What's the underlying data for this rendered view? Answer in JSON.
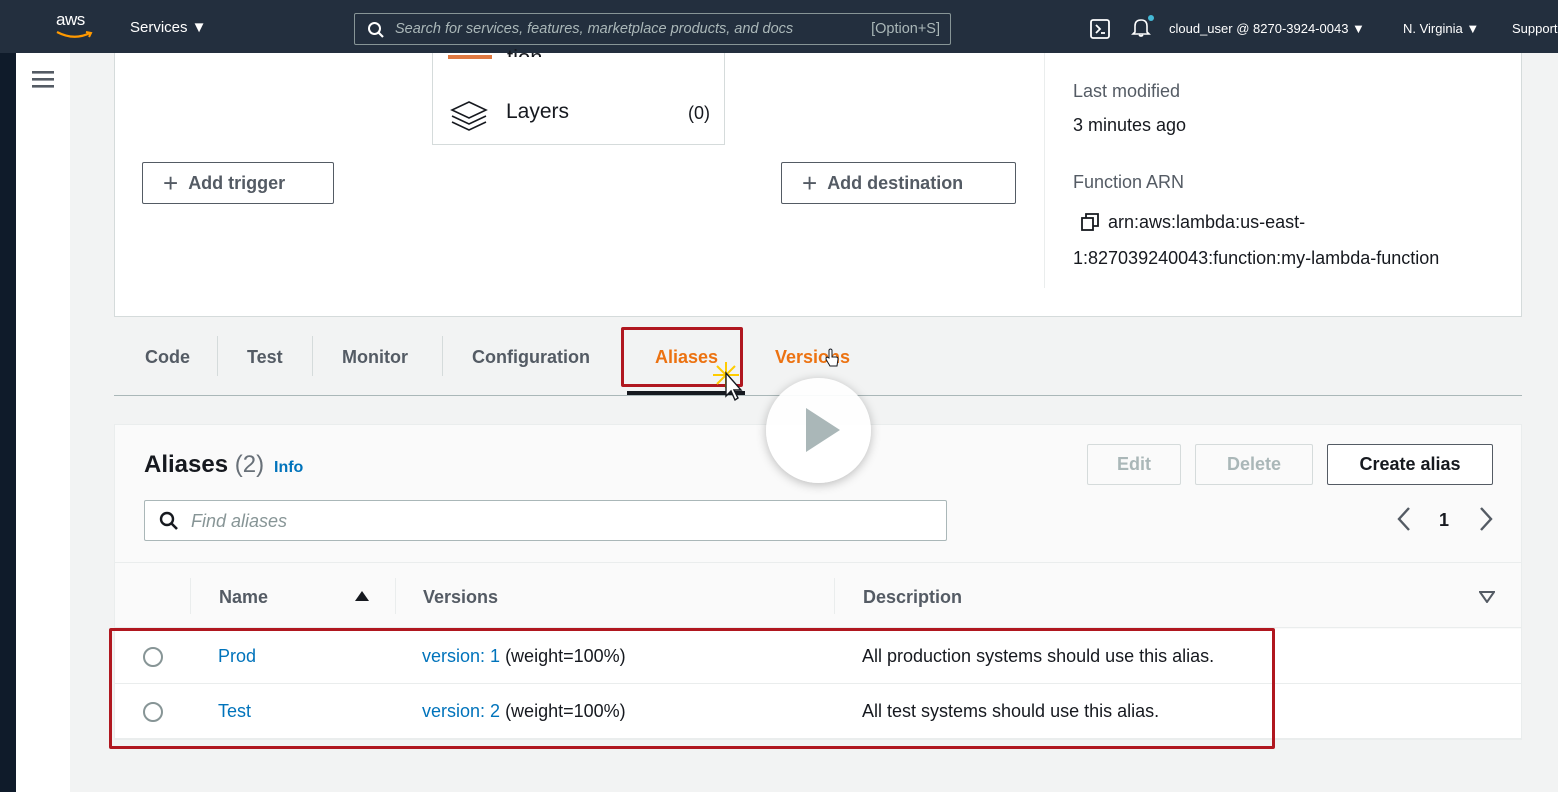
{
  "topnav": {
    "logo": "aws",
    "services": "Services ▼",
    "search_placeholder": "Search for services, features, marketplace products, and docs",
    "search_shortcut": "[Option+S]",
    "user": "cloud_user @ 8270-3924-0043 ▼",
    "region": "N. Virginia ▼",
    "support": "Support"
  },
  "overview": {
    "partial_title": "tion",
    "layers_label": "Layers",
    "layers_count": "(0)",
    "add_trigger": "Add trigger",
    "add_destination": "Add destination",
    "last_modified_label": "Last modified",
    "last_modified_value": "3 minutes ago",
    "arn_label": "Function ARN",
    "arn_line1": "arn:aws:lambda:us-east-",
    "arn_line2": "1:827039240043:function:my-lambda-function"
  },
  "tabs": [
    "Code",
    "Test",
    "Monitor",
    "Configuration",
    "Aliases",
    "Versions"
  ],
  "active_tab": "Aliases",
  "aliases": {
    "title": "Aliases",
    "count": "(2)",
    "info": "Info",
    "edit": "Edit",
    "delete": "Delete",
    "create": "Create alias",
    "search_placeholder": "Find aliases",
    "page": "1",
    "columns": [
      "Name",
      "Versions",
      "Description"
    ],
    "rows": [
      {
        "name": "Prod",
        "version_link": "version: 1",
        "weight": "(weight=100%)",
        "description": "All production systems should use this alias."
      },
      {
        "name": "Test",
        "version_link": "version: 2",
        "weight": "(weight=100%)",
        "description": "All test systems should use this alias."
      }
    ]
  },
  "colors": {
    "nav": "#232f3e",
    "accent": "#ec7211",
    "link": "#0073bb",
    "highlight": "#b0171f"
  }
}
